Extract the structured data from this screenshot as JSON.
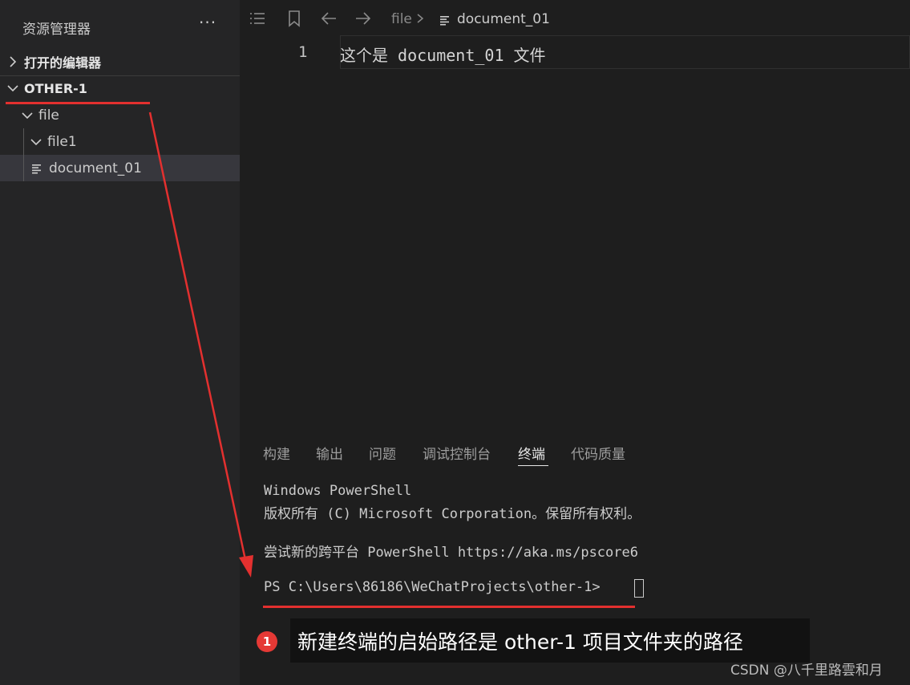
{
  "sidebar": {
    "title": "资源管理器",
    "more_label": "···",
    "open_editors_label": "打开的编辑器",
    "project_label": "OTHER-1",
    "tree": [
      {
        "label": "file"
      },
      {
        "label": "file1"
      },
      {
        "label": "document_01"
      }
    ]
  },
  "editor": {
    "breadcrumb": [
      "file",
      "document_01"
    ],
    "line_number": "1",
    "line_text": "这个是 document_01 文件"
  },
  "panel": {
    "tabs": [
      "构建",
      "输出",
      "问题",
      "调试控制台",
      "终端",
      "代码质量"
    ],
    "active_tab": "终端",
    "terminal_lines": [
      "Windows PowerShell",
      "版权所有 (C) Microsoft Corporation。保留所有权利。",
      "",
      "尝试新的跨平台 PowerShell https://aka.ms/pscore6",
      "",
      "PS C:\\Users\\86186\\WeChatProjects\\other-1> "
    ]
  },
  "annotation": {
    "number": "1",
    "text": "新建终端的启始路径是 other-1 项目文件夹的路径",
    "color": "#e3302f"
  },
  "watermark": "CSDN @八千里路雲和月",
  "icons": {
    "toolbar": [
      "list-icon",
      "bookmark-icon",
      "arrow-left-icon",
      "arrow-right-icon"
    ],
    "file": "text-file-icon"
  }
}
